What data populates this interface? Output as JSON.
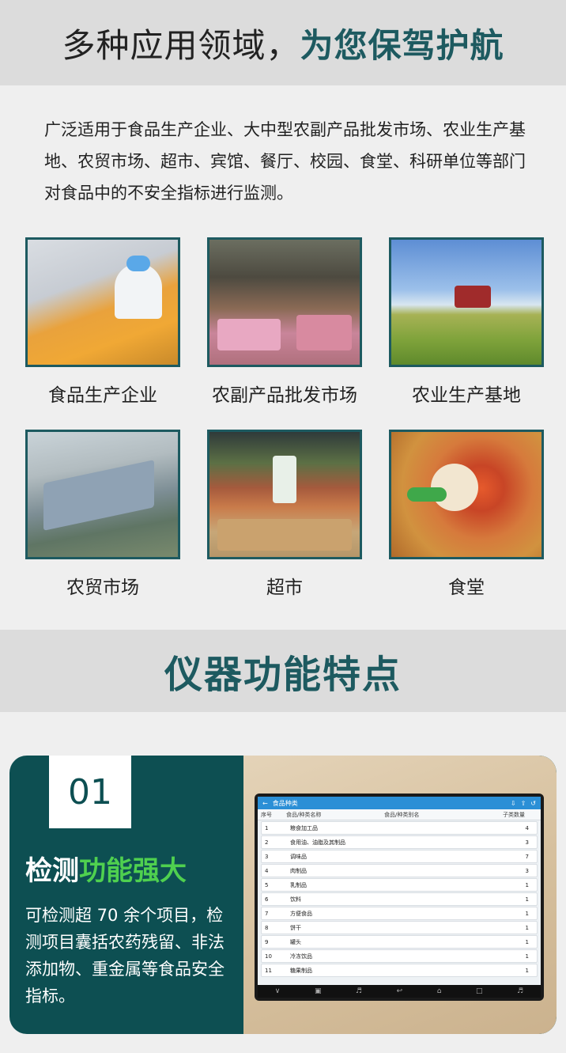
{
  "header": {
    "title_part1": "多种应用领域，",
    "title_part2": "为您保驾护航"
  },
  "intro": {
    "text": "广泛适用于食品生产企业、大中型农副产品批发市场、农业生产基地、农贸市场、超市、宾馆、餐厅、校园、食堂、科研单位等部门对食品中的不安全指标进行监测。"
  },
  "applications": [
    {
      "label": "食品生产企业"
    },
    {
      "label": "农副产品批发市场"
    },
    {
      "label": "农业生产基地"
    },
    {
      "label": "农贸市场"
    },
    {
      "label": "超市"
    },
    {
      "label": "食堂"
    }
  ],
  "section2": {
    "title": "仪器功能特点"
  },
  "feature": {
    "number": "01",
    "title_white": "检测",
    "title_green": "功能强大",
    "desc": "可检测超 70 余个项目，检测项目囊括农药残留、非法添加物、重金属等食品安全指标。"
  },
  "device_screen": {
    "bar_title": "食品种类",
    "columns": [
      "序号",
      "食品/种类名称",
      "食品/种类别名",
      "子类数量"
    ],
    "rows": [
      {
        "no": "1",
        "name": "粮食加工品",
        "alias": "",
        "count": "4"
      },
      {
        "no": "2",
        "name": "食用油、油脂及其制品",
        "alias": "",
        "count": "3"
      },
      {
        "no": "3",
        "name": "调味品",
        "alias": "",
        "count": "7"
      },
      {
        "no": "4",
        "name": "肉制品",
        "alias": "",
        "count": "3"
      },
      {
        "no": "5",
        "name": "乳制品",
        "alias": "",
        "count": "1"
      },
      {
        "no": "6",
        "name": "饮料",
        "alias": "",
        "count": "1"
      },
      {
        "no": "7",
        "name": "方便食品",
        "alias": "",
        "count": "1"
      },
      {
        "no": "8",
        "name": "饼干",
        "alias": "",
        "count": "1"
      },
      {
        "no": "9",
        "name": "罐头",
        "alias": "",
        "count": "1"
      },
      {
        "no": "10",
        "name": "冷冻饮品",
        "alias": "",
        "count": "1"
      },
      {
        "no": "11",
        "name": "糖果制品",
        "alias": "",
        "count": "1"
      }
    ]
  },
  "colors": {
    "accent": "#1d5a60",
    "panel": "#0d4f52",
    "highlight": "#4fd04f"
  }
}
